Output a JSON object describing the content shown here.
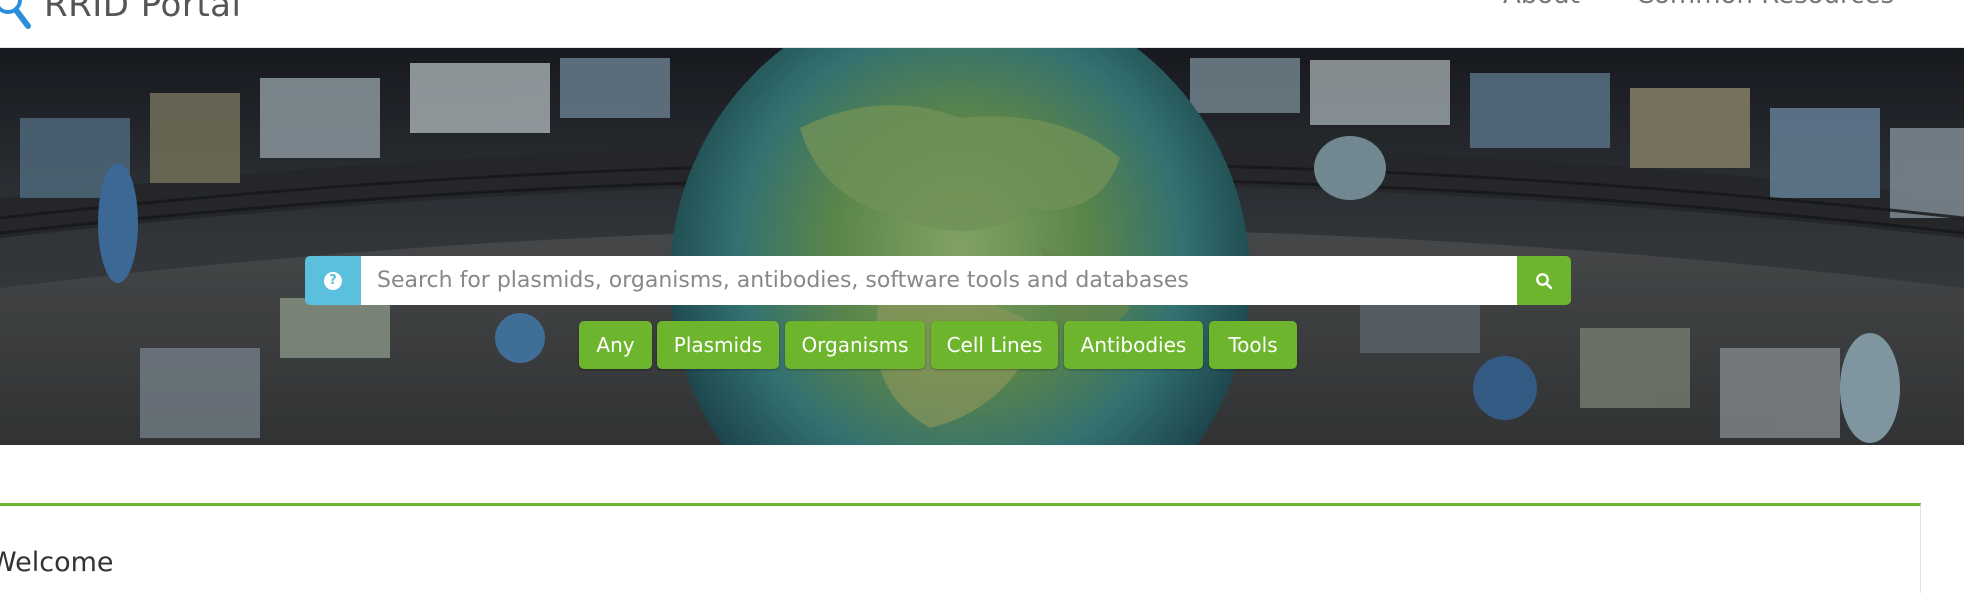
{
  "brand": {
    "name": "RRID Portal",
    "logo_icon": "magnifier-logo-icon"
  },
  "nav": {
    "items": [
      {
        "label": "About"
      },
      {
        "label": "Common Resources"
      }
    ]
  },
  "search": {
    "placeholder": "Search for plasmids, organisms, antibodies, software tools and databases",
    "value": "",
    "help_icon": "question-circle-icon",
    "submit_icon": "search-icon"
  },
  "filters": [
    {
      "label": "Any"
    },
    {
      "label": "Plasmids"
    },
    {
      "label": "Organisms"
    },
    {
      "label": "Cell Lines"
    },
    {
      "label": "Antibodies"
    },
    {
      "label": "Tools"
    }
  ],
  "welcome": {
    "title": "Welcome"
  },
  "colors": {
    "accent_green": "#6cb52d",
    "help_blue": "#5bc0de",
    "brand_blue": "#2a8fd8"
  }
}
